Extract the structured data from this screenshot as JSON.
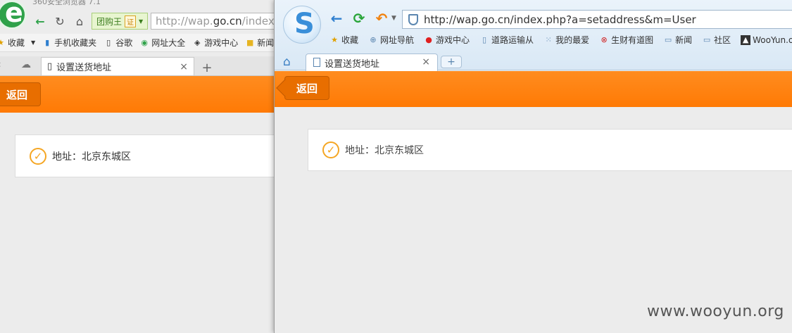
{
  "back_window": {
    "title": "360安全浏览器 7.1",
    "group_label": "团购王",
    "cert_label": "证",
    "url_prefix": "http://wap.",
    "url_domain": "go.cn",
    "url_suffix": "/index",
    "bookmarks": [
      {
        "label": "收藏",
        "icon": "star-icon"
      },
      {
        "label": "手机收藏夹",
        "icon": "phone-icon"
      },
      {
        "label": "谷歌",
        "icon": "doc-icon"
      },
      {
        "label": "网址大全",
        "icon": "sites-icon"
      },
      {
        "label": "游戏中心",
        "icon": "gamepad-icon"
      },
      {
        "label": "新闻",
        "icon": "folder-icon"
      }
    ],
    "tab_title": "设置送货地址",
    "back_label": "返回",
    "address_text": "地址：北京东城区"
  },
  "front_window": {
    "url": "http://wap.go.cn/index.php?a=setaddress&m=User",
    "bookmarks": [
      {
        "label": "收藏",
        "icon": "star-icon"
      },
      {
        "label": "网址导航",
        "icon": "globe-icon"
      },
      {
        "label": "游戏中心",
        "icon": "game-icon"
      },
      {
        "label": "道路运输从",
        "icon": "doc-icon"
      },
      {
        "label": "我的最爱",
        "icon": "grid-icon"
      },
      {
        "label": "生财有道图",
        "icon": "money-icon"
      },
      {
        "label": "新闻",
        "icon": "folder-icon"
      },
      {
        "label": "社区",
        "icon": "folder-icon"
      },
      {
        "label": "WooYun.o",
        "icon": "wooyun-icon"
      }
    ],
    "tab_title": "设置送货地址",
    "back_label": "返回",
    "address_text": "地址：北京东城区"
  },
  "watermark": "www.wooyun.org",
  "colors": {
    "header_orange": "#ff7a05",
    "back_button": "#e86e00",
    "check_orange": "#f5a623"
  }
}
